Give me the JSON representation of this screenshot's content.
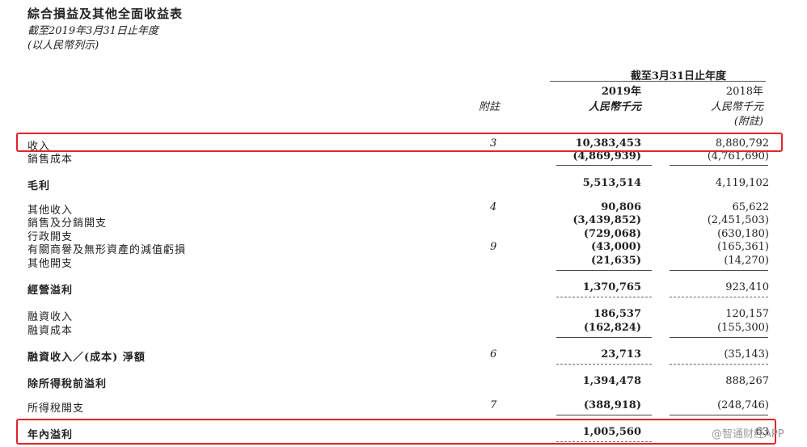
{
  "header": {
    "title": "綜合損益及其他全面收益表",
    "subtitle_period": "截至2019年3月31日止年度",
    "subtitle_currency": "(以人民幣列示)"
  },
  "columns": {
    "period_header": "截至3月31日止年度",
    "note_header": "附註",
    "year_2019": "2019年",
    "year_2018": "2018年",
    "unit_2019": "人民幣千元",
    "unit_2018": "人民幣千元",
    "restated_2018": "(附註)"
  },
  "rows": [
    {
      "label": "收入",
      "note": "3",
      "v2019": "10,383,453",
      "v2018": "8,880,792"
    },
    {
      "label": "銷售成本",
      "note": "",
      "v2019": "(4,869,939)",
      "v2018": "(4,761,690)"
    },
    {
      "label": "毛利",
      "note": "",
      "v2019": "5,513,514",
      "v2018": "4,119,102"
    },
    {
      "label": "其他收入",
      "note": "4",
      "v2019": "90,806",
      "v2018": "65,622"
    },
    {
      "label": "銷售及分銷開支",
      "note": "",
      "v2019": "(3,439,852)",
      "v2018": "(2,451,503)"
    },
    {
      "label": "行政開支",
      "note": "",
      "v2019": "(729,068)",
      "v2018": "(630,180)"
    },
    {
      "label": "有關商譽及無形資產的減值虧損",
      "note": "9",
      "v2019": "(43,000)",
      "v2018": "(165,361)"
    },
    {
      "label": "其他開支",
      "note": "",
      "v2019": "(21,635)",
      "v2018": "(14,270)"
    },
    {
      "label": "經營溢利",
      "note": "",
      "v2019": "1,370,765",
      "v2018": "923,410"
    },
    {
      "label": "融資收入",
      "note": "",
      "v2019": "186,537",
      "v2018": "120,157"
    },
    {
      "label": "融資成本",
      "note": "",
      "v2019": "(162,824)",
      "v2018": "(155,300)"
    },
    {
      "label": "融資收入／(成本) 淨額",
      "note": "6",
      "v2019": "23,713",
      "v2018": "(35,143)"
    },
    {
      "label": "除所得稅前溢利",
      "note": "",
      "v2019": "1,394,478",
      "v2018": "888,267"
    },
    {
      "label": "所得稅開支",
      "note": "7",
      "v2019": "(388,918)",
      "v2018": "(248,746)"
    },
    {
      "label": "年內溢利",
      "note": "",
      "v2019": "1,005,560",
      "v2018": "63"
    }
  ],
  "watermark": "@智通财经APP",
  "colors": {
    "highlight_box": "#e0242a",
    "text": "#222222"
  }
}
